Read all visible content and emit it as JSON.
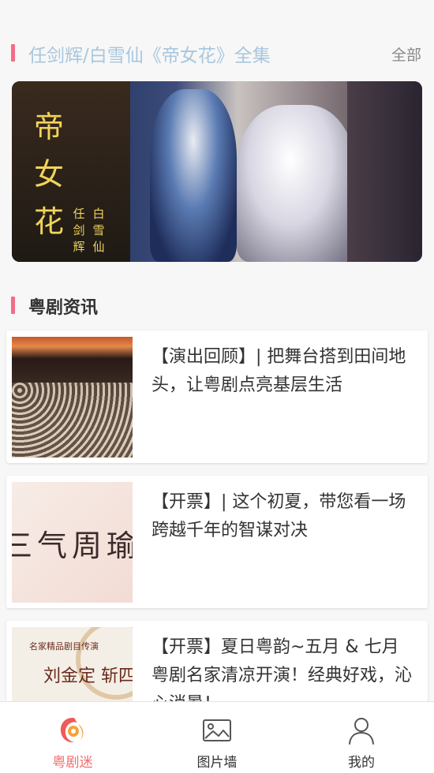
{
  "status_bar": {
    "left": "",
    "right": ""
  },
  "collection": {
    "title": "任剑辉/白雪仙《帝女花》全集",
    "more_label": "全部",
    "banner": {
      "title_chars": [
        "帝",
        "女",
        "花"
      ],
      "cast_1": [
        "任",
        "剑",
        "辉"
      ],
      "cast_2": [
        "白",
        "雪",
        "仙"
      ]
    }
  },
  "news": {
    "section_title": "粤剧资讯",
    "items": [
      {
        "title": "【演出回顾】| 把舞台搭到田间地头，让粤剧点亮基层生活"
      },
      {
        "title": "【开票】| 这个初夏，带您看一场跨越千年的智谋对决",
        "thumb_text": "三气周瑜"
      },
      {
        "title": "【开票】夏日粤韵~五月 & 七月粤剧名家清凉开演！经典好戏，沁心消暑！",
        "thumb_small": "名家精品剧目传演",
        "thumb_big": "刘金定 斩四门"
      }
    ]
  },
  "tabbar": {
    "items": [
      {
        "label": "粤剧迷",
        "icon": "opera-logo-icon",
        "active": true
      },
      {
        "label": "图片墙",
        "icon": "image-icon",
        "active": false
      },
      {
        "label": "我的",
        "icon": "user-icon",
        "active": false
      }
    ]
  },
  "colors": {
    "accent": "#f26d87",
    "active_tab": "#f26d6d",
    "collection_title": "#a8c7de"
  }
}
